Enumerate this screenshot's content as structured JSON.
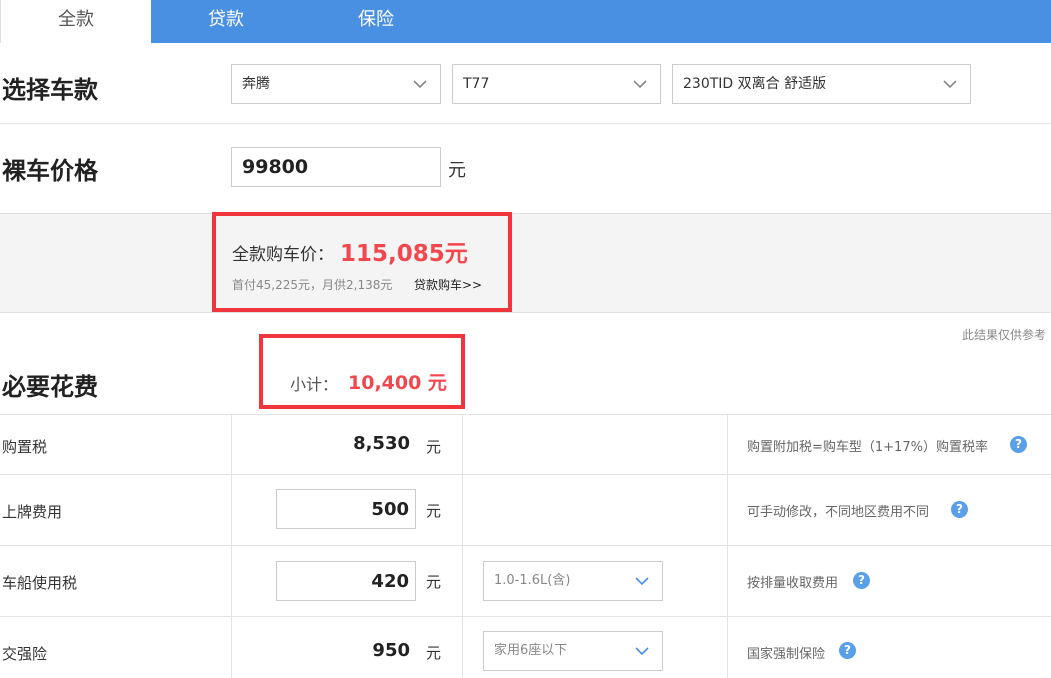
{
  "tabs": [
    {
      "label": "全款"
    },
    {
      "label": "贷款"
    },
    {
      "label": "保险"
    }
  ],
  "select_car": {
    "title": "选择车款",
    "brand": "奔腾",
    "series": "T77",
    "model": "230TID 双离合 舒适版"
  },
  "bare_price": {
    "title": "裸车价格",
    "value": "99800",
    "unit": "元"
  },
  "summary": {
    "total_label": "全款购车价：",
    "total_value": "115,085元",
    "sub_text": "首付45,225元，月供2,138元",
    "loan_link": "贷款购车>>",
    "note": "此结果仅供参考"
  },
  "required": {
    "title": "必要花费",
    "subtotal_label": "小计：",
    "subtotal_value": "10,400 元"
  },
  "rows": [
    {
      "label": "购置税",
      "value": "8,530",
      "unit": "元",
      "hint": "购置附加税=购车型（1+17%）购置税率"
    },
    {
      "label": "上牌费用",
      "value": "500",
      "unit": "元",
      "hint": "可手动修改，不同地区费用不同"
    },
    {
      "label": "车船使用税",
      "value": "420",
      "unit": "元",
      "option": "1.0-1.6L(含)",
      "hint": "按排量收取费用"
    },
    {
      "label": "交强险",
      "value": "950",
      "unit": "元",
      "option": "家用6座以下",
      "hint": "国家强制保险"
    }
  ],
  "help_glyph": "?",
  "accent_color": "#4a90e2",
  "highlight_color": "#f0484e",
  "icons": [
    "chevron-down-icon",
    "help-icon"
  ]
}
